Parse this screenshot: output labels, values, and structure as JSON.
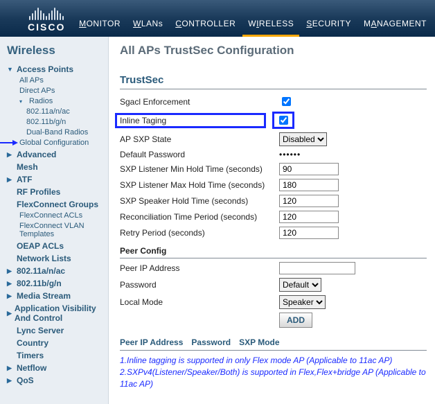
{
  "brand": "CISCO",
  "nav": {
    "monitor": "MONITOR",
    "wlans": "WLANs",
    "controller": "CONTROLLER",
    "wireless": "WIRELESS",
    "security": "SECURITY",
    "management": "MANAGEMENT"
  },
  "sidebar": {
    "title": "Wireless",
    "ap": {
      "label": "Access Points",
      "all": "All APs",
      "direct": "Direct APs",
      "radios": "Radios",
      "r1": "802.11a/n/ac",
      "r2": "802.11b/g/n",
      "r3": "Dual-Band Radios",
      "global": "Global Configuration"
    },
    "advanced": "Advanced",
    "mesh": "Mesh",
    "atf": "ATF",
    "rf": "RF Profiles",
    "flex": {
      "label": "FlexConnect Groups",
      "acls": "FlexConnect ACLs",
      "vlan": "FlexConnect VLAN Templates"
    },
    "oeap": "OEAP ACLs",
    "netlists": "Network Lists",
    "b11a": "802.11a/n/ac",
    "b11b": "802.11b/g/n",
    "media": "Media Stream",
    "appvis": "Application Visibility And Control",
    "lync": "Lync Server",
    "country": "Country",
    "timers": "Timers",
    "netflow": "Netflow",
    "qos": "QoS"
  },
  "page": {
    "title": "All APs TrustSec Configuration",
    "section": "TrustSec",
    "sgacl": "Sgacl Enforcement",
    "inline": "Inline Taging",
    "sxp_state_label": "AP SXP State",
    "sxp_state_value": "Disabled",
    "default_pw_label": "Default Password",
    "default_pw_value": "••••••",
    "lmin_label": "SXP Listener Min Hold Time (seconds)",
    "lmin_value": "90",
    "lmax_label": "SXP Listener Max Hold Time (seconds)",
    "lmax_value": "180",
    "shold_label": "SXP Speaker Hold Time (seconds)",
    "shold_value": "120",
    "recon_label": "Reconciliation Time Period (seconds)",
    "recon_value": "120",
    "retry_label": "Retry Period (seconds)",
    "retry_value": "120",
    "peer_config": "Peer Config",
    "peer_ip_label": "Peer IP Address",
    "peer_pw_label": "Password",
    "peer_pw_value": "Default",
    "local_mode_label": "Local Mode",
    "local_mode_value": "Speaker",
    "add": "ADD",
    "tbl_ip": "Peer IP Address",
    "tbl_pw": "Password",
    "tbl_mode": "SXP Mode",
    "note1": "1.Inline tagging is supported in only Flex mode AP (Applicable to 11ac AP)",
    "note2": "2.SXPv4(Listener/Speaker/Both) is supported in Flex,Flex+bridge AP (Applicable to 11ac AP)"
  }
}
